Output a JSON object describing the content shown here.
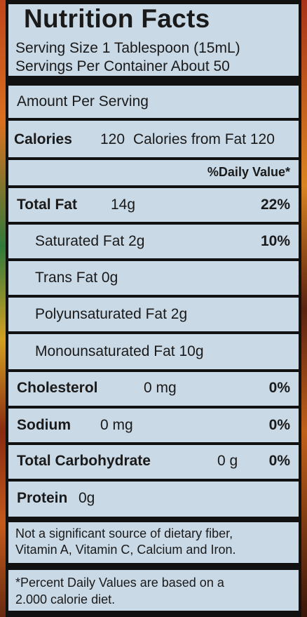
{
  "header": {
    "title": "Nutrition Facts",
    "serving_size": "Serving Size 1 Tablespoon (15mL)",
    "servings_per_container": "Servings Per Container About 50"
  },
  "amount_per_serving": "Amount Per Serving",
  "calories": {
    "label": "Calories",
    "value": "120",
    "from_fat": "Calories from Fat 120"
  },
  "daily_value_header": "%Daily Value*",
  "nutrients": {
    "total_fat": {
      "label": "Total Fat",
      "amount": "14g",
      "dv": "22%"
    },
    "saturated_fat": {
      "label": "Saturated Fat 2g",
      "dv": "10%"
    },
    "trans_fat": {
      "label": "Trans Fat 0g"
    },
    "polyunsaturated_fat": {
      "label": "Polyunsaturated Fat 2g"
    },
    "monounsaturated_fat": {
      "label": "Monounsaturated Fat 10g"
    },
    "cholesterol": {
      "label": "Cholesterol",
      "amount": "0 mg",
      "dv": "0%"
    },
    "sodium": {
      "label": "Sodium",
      "amount": "0 mg",
      "dv": "0%"
    },
    "total_carbohydrate": {
      "label": "Total Carbohydrate",
      "amount": "0 g",
      "dv": "0%"
    },
    "protein": {
      "label": "Protein",
      "amount": "0g"
    }
  },
  "footnotes": {
    "not_significant_line1": "Not a significant source of dietary fiber,",
    "not_significant_line2": "Vitamin A, Vitamin C, Calcium and Iron.",
    "percent_dv_line1": "*Percent Daily Values are based on a",
    "percent_dv_line2": "2.000 calorie diet."
  },
  "colors": {
    "panel_background": "#c9d9e6",
    "rule": "#111111"
  }
}
